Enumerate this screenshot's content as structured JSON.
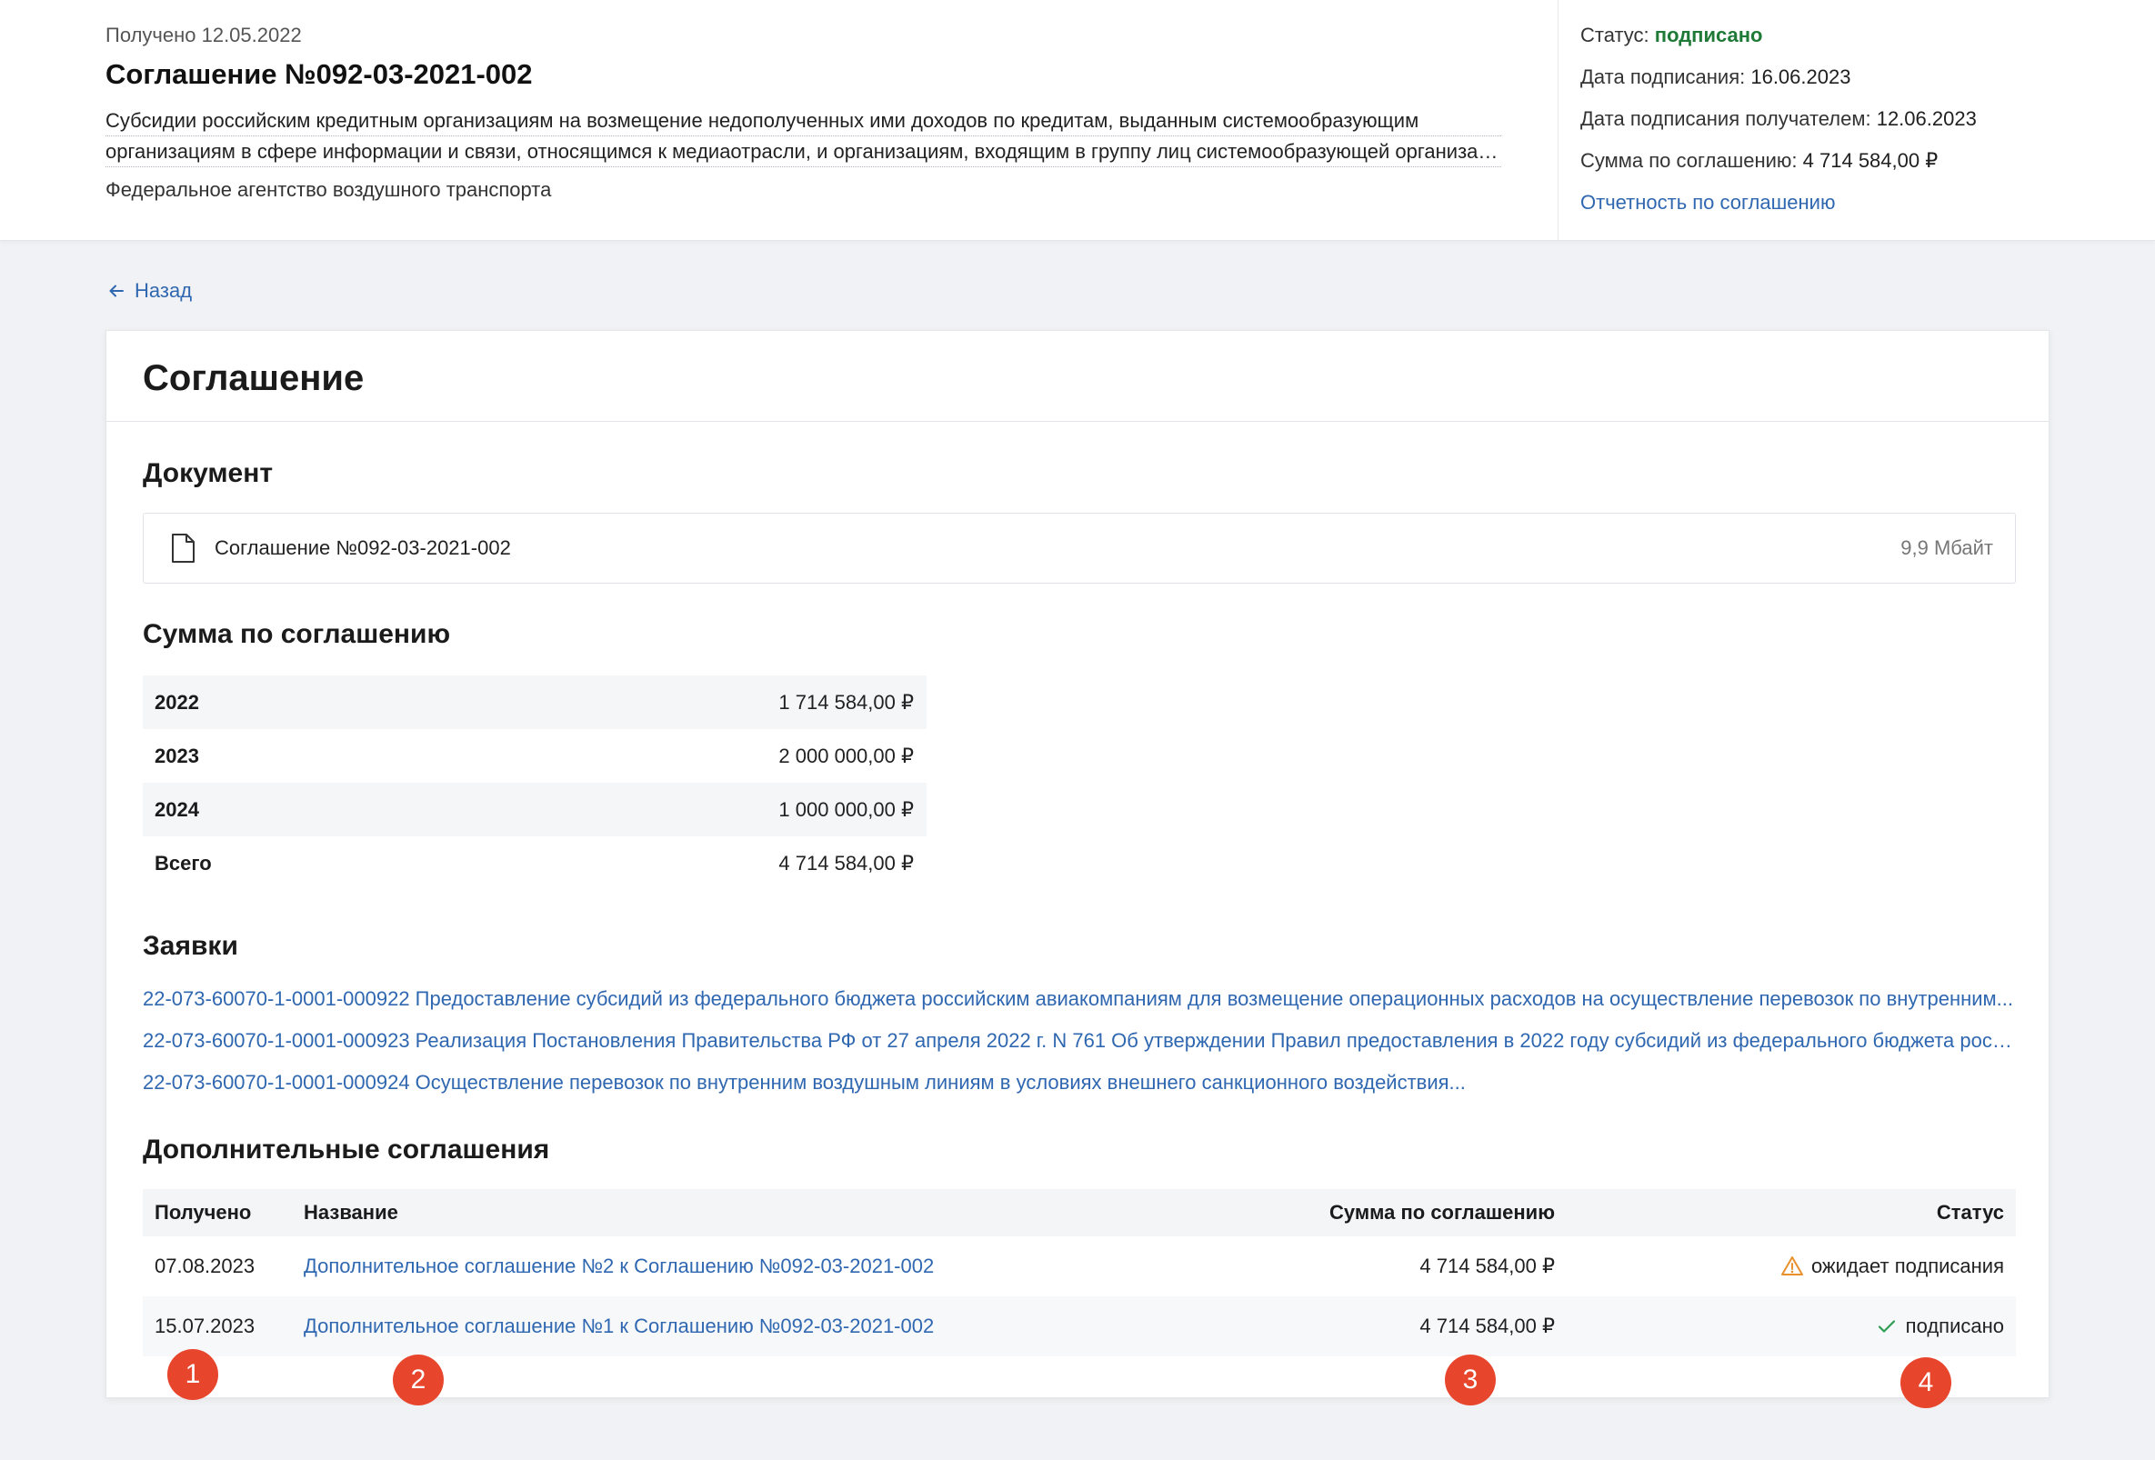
{
  "header": {
    "received": "Получено 12.05.2022",
    "title": "Соглашение №092-03-2021-002",
    "description_line1": "Субсидии российским кредитным организациям на возмещение недополученных ими доходов по кредитам, выданным системообразующим",
    "description_line2": "организациям в сфере информации и связи, относящимся к медиаотрасли, и организациям, входящим в группу лиц системообразующей организации...",
    "agency": "Федеральное агентство воздушного транспорта",
    "status_label": "Статус: ",
    "status_value": "подписано",
    "sign_date_label": "Дата подписания: ",
    "sign_date_value": "16.06.2023",
    "recipient_sign_label": "Дата подписания получателем: ",
    "recipient_sign_value": "12.06.2023",
    "sum_label": "Сумма по соглашению: ",
    "sum_value": "4 714 584,00 ₽",
    "report_link": "Отчетность по соглашению",
    "colors": {
      "signed": "#1e7a36",
      "link": "#2f67b0"
    }
  },
  "back": {
    "label": "Назад",
    "icon": "arrow-left-icon"
  },
  "card": {
    "title": "Соглашение",
    "document": {
      "heading": "Документ",
      "file_name": "Соглашение №092-03-2021-002",
      "file_size": "9,9 Мбайт",
      "icon": "document-icon"
    },
    "sum": {
      "heading": "Сумма по соглашению",
      "rows": [
        {
          "label": "2022",
          "amount": "1 714 584,00 ₽"
        },
        {
          "label": "2023",
          "amount": "2 000 000,00 ₽"
        },
        {
          "label": "2024",
          "amount": "1 000 000,00 ₽"
        },
        {
          "label": "Всего",
          "amount": "4 714 584,00 ₽"
        }
      ]
    },
    "requests": {
      "heading": "Заявки",
      "items": [
        "22-073-60070-1-0001-000922 Предоставление субсидий из федерального бюджета российским авиакомпаниям для возмещение операционных расходов на осуществление перевозок по внутренним...",
        "22-073-60070-1-0001-000923 Реализация Постановления Правительства РФ от 27 апреля 2022 г. N 761 Об утверждении Правил предоставления в 2022 году субсидий из федерального бюджета россий...",
        "22-073-60070-1-0001-000924 Осуществление перевозок по внутренним воздушным линиям в условиях внешнего санкционного воздействия..."
      ]
    },
    "additional": {
      "heading": "Дополнительные соглашения",
      "columns": {
        "received": "Получено",
        "name": "Название",
        "sum": "Сумма по соглашению",
        "status": "Статус"
      },
      "rows": [
        {
          "received": "07.08.2023",
          "name": "Дополнительное соглашение №2 к Соглашению №092-03-2021-002",
          "sum": "4 714 584,00 ₽",
          "status": "ожидает подписания",
          "status_icon": "warning-icon"
        },
        {
          "received": "15.07.2023",
          "name": "Дополнительное соглашение №1 к Соглашению №092-03-2021-002",
          "sum": "4 714 584,00 ₽",
          "status": "подписано",
          "status_icon": "check-icon"
        }
      ]
    }
  },
  "markers": [
    "1",
    "2",
    "3",
    "4"
  ],
  "marker_color": "#e8452d"
}
